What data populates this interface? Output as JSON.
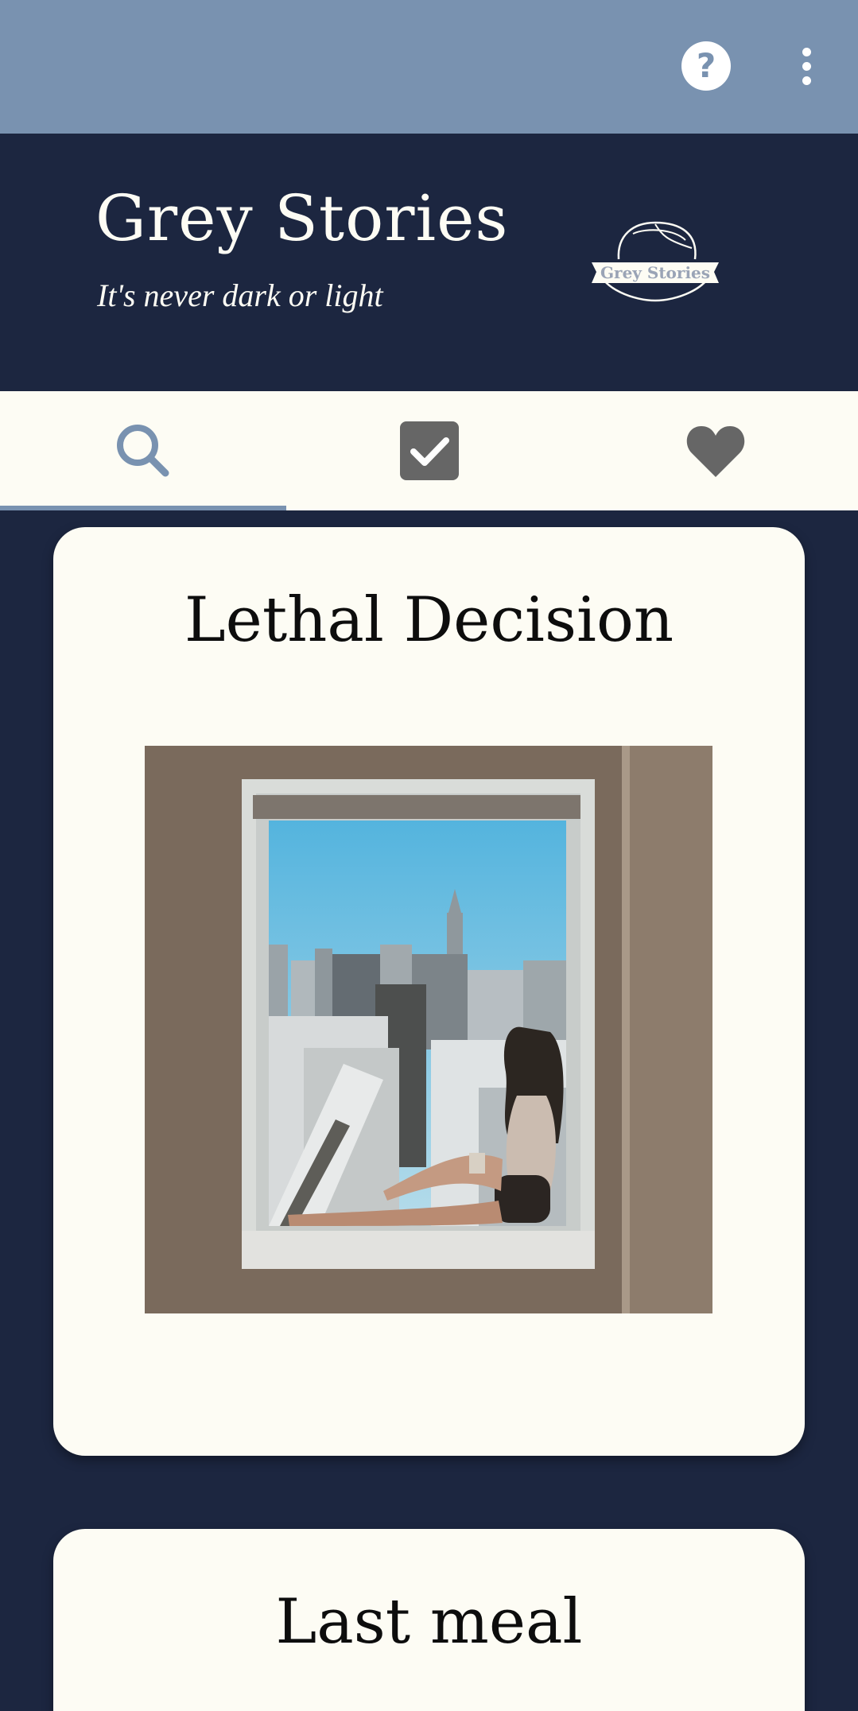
{
  "app": {
    "title": "Grey Stories",
    "tagline": "It's never dark or light",
    "logo_text": "Grey Stories"
  },
  "toolbar": {
    "help_icon": "help-circle-icon",
    "menu_icon": "more-vertical-icon"
  },
  "tabs": [
    {
      "icon": "search-icon",
      "selected": true
    },
    {
      "icon": "checkbox-icon",
      "selected": false
    },
    {
      "icon": "heart-icon",
      "selected": false
    }
  ],
  "stories": [
    {
      "title": "Lethal Decision",
      "image": "woman sitting in window overlooking city"
    },
    {
      "title": "Last meal"
    }
  ],
  "colors": {
    "appbar": "#7992b0",
    "header": "#1c2640",
    "card": "#fdfcf4",
    "accent": "#7992b0",
    "icon_inactive": "#666666"
  }
}
